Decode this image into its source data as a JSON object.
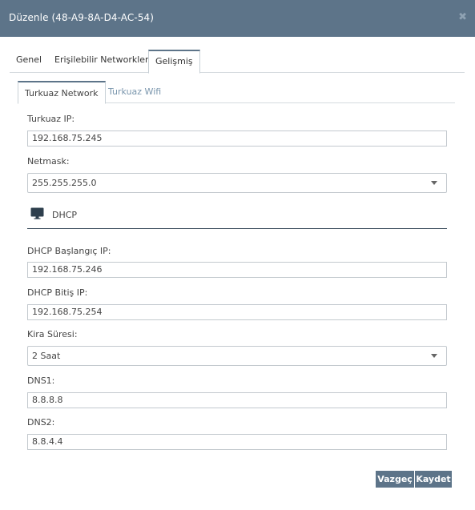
{
  "dialog": {
    "title": "Düzenle (48-A9-8A-D4-AC-54)",
    "close_glyph": "✖"
  },
  "tabs": [
    "Genel",
    "Erişilebilir Networkler",
    "Gelişmiş"
  ],
  "subtabs": [
    "Turkuaz Network",
    "Turkuaz Wifi"
  ],
  "form": {
    "turkuaz_ip": {
      "label": "Turkuaz IP:",
      "value": "192.168.75.245"
    },
    "netmask": {
      "label": "Netmask:",
      "value": "255.255.255.0"
    },
    "dhcp_section": {
      "label": "DHCP",
      "icon": "monitor-icon"
    },
    "dhcp_start": {
      "label": "DHCP Başlangıç IP:",
      "value": "192.168.75.246"
    },
    "dhcp_end": {
      "label": "DHCP Bitiş IP:",
      "value": "192.168.75.254"
    },
    "lease": {
      "label": "Kira Süresi:",
      "value": "2 Saat"
    },
    "dns1": {
      "label": "DNS1:",
      "value": "8.8.8.8"
    },
    "dns2": {
      "label": "DNS2:",
      "value": "8.8.4.4"
    }
  },
  "buttons": {
    "cancel": "Vazgeç",
    "save": "Kaydet"
  },
  "colors": {
    "header": "#5d7489",
    "inactive_tab": "#7a96ad",
    "section_rule": "#3d4f5e"
  }
}
